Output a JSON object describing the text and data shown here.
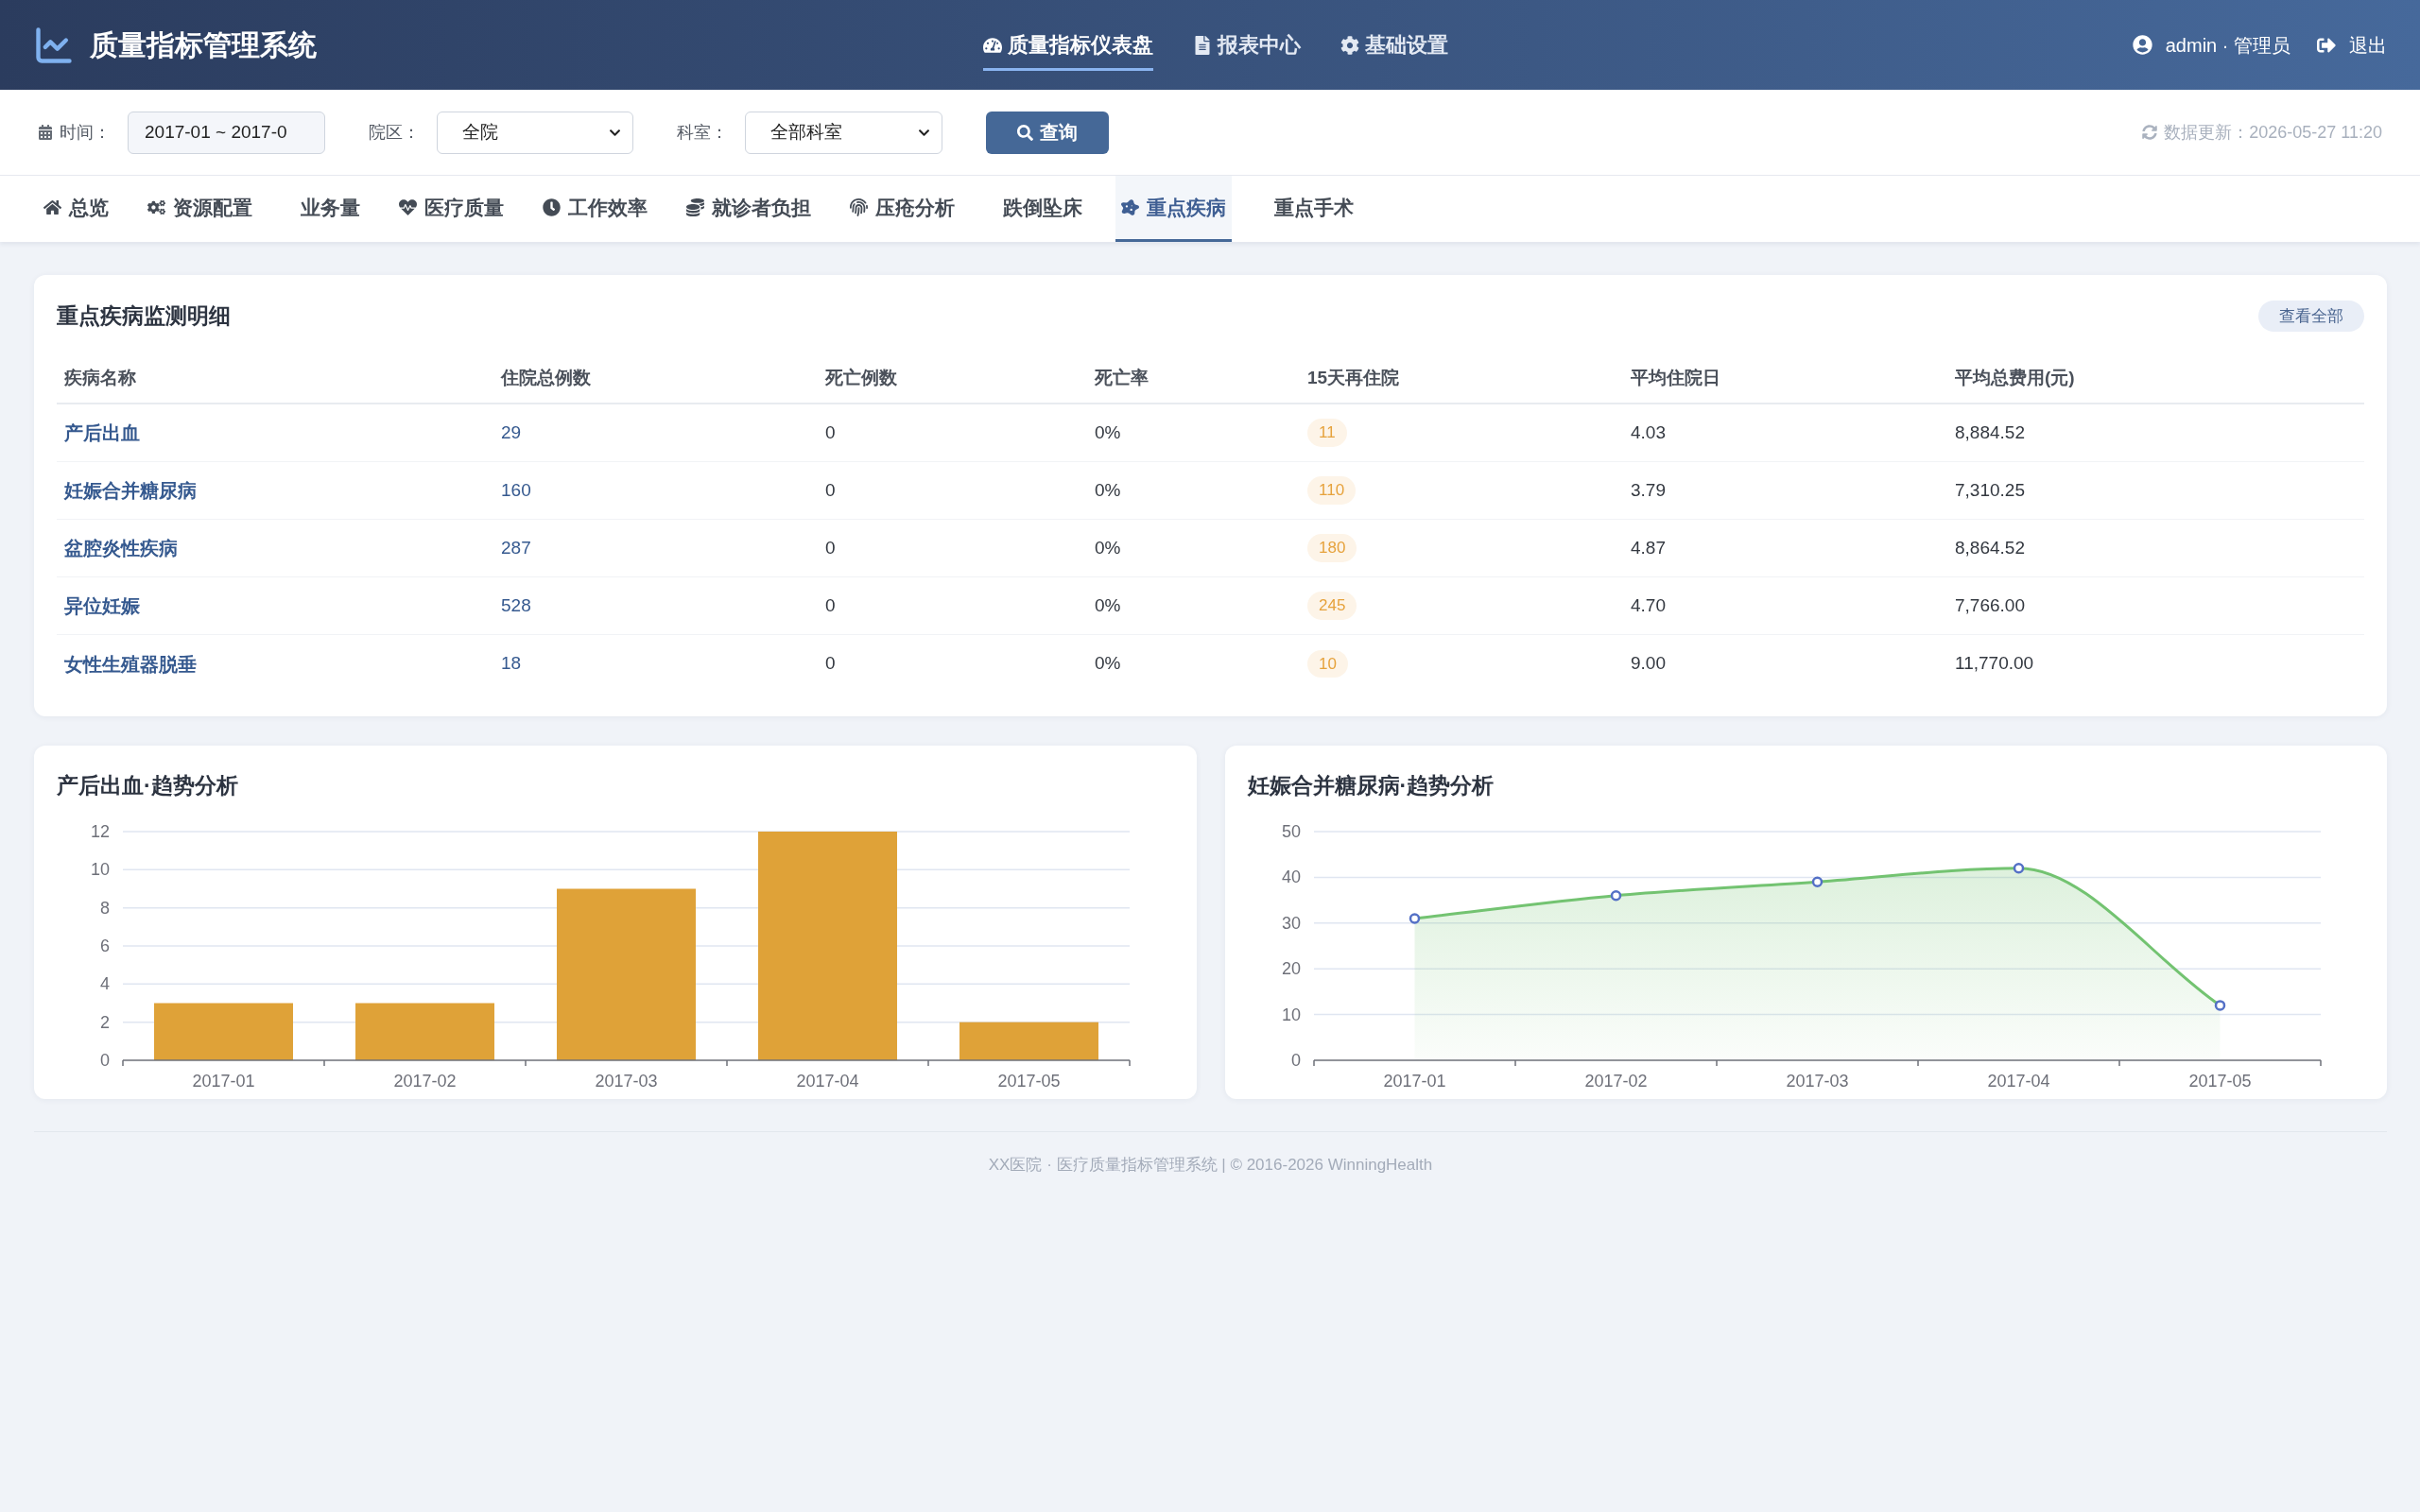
{
  "header": {
    "title": "质量指标管理系统",
    "nav": [
      {
        "label": "质量指标仪表盘",
        "selected": true
      },
      {
        "label": "报表中心",
        "selected": false
      },
      {
        "label": "基础设置",
        "selected": false
      }
    ],
    "user": "admin · 管理员",
    "logout": "退出"
  },
  "filters": {
    "date": {
      "label": "时间：",
      "value": "2017-01 ~ 2017-0"
    },
    "campus": {
      "label": "院区：",
      "value": "全院"
    },
    "department": {
      "label": "科室：",
      "value": "全部科室"
    },
    "search_button": "查询",
    "last_updated": "数据更新：2026-05-27 11:20"
  },
  "tabs": [
    {
      "label": "总览",
      "selected": false
    },
    {
      "label": "资源配置",
      "selected": false
    },
    {
      "label": "业务量",
      "selected": false
    },
    {
      "label": "医疗质量",
      "selected": false
    },
    {
      "label": "工作效率",
      "selected": false
    },
    {
      "label": "就诊者负担",
      "selected": false
    },
    {
      "label": "压疮分析",
      "selected": false
    },
    {
      "label": "跌倒坠床",
      "selected": false
    },
    {
      "label": "重点疾病",
      "selected": true
    },
    {
      "label": "重点手术",
      "selected": false
    }
  ],
  "detail": {
    "title": "重点疾病监测明细",
    "view_all": "查看全部",
    "table": {
      "columns": [
        "疾病名称",
        "住院总例数",
        "死亡例数",
        "死亡率",
        "15天再住院",
        "平均住院日",
        "平均总费用(元)"
      ],
      "rows": [
        [
          "产后出血",
          "29",
          "0",
          "0%",
          "11",
          "4.03",
          "8,884.52"
        ],
        [
          "妊娠合并糖尿病",
          "160",
          "0",
          "0%",
          "110",
          "3.79",
          "7,310.25"
        ],
        [
          "盆腔炎性疾病",
          "287",
          "0",
          "0%",
          "180",
          "4.87",
          "8,864.52"
        ],
        [
          "异位妊娠",
          "528",
          "0",
          "0%",
          "245",
          "4.70",
          "7,766.00"
        ],
        [
          "女性生殖器脱垂",
          "18",
          "0",
          "0%",
          "10",
          "9.00",
          "11,770.00"
        ]
      ]
    }
  },
  "charts": [
    {
      "chart_data": {
        "type": "bar",
        "title": "产后出血·趋势分析",
        "categories": [
          "2017-01",
          "2017-02",
          "2017-03",
          "2017-04",
          "2017-05"
        ],
        "values": [
          3,
          3,
          9,
          12,
          2
        ],
        "color": "#dfa238",
        "ylim": [
          0,
          12
        ],
        "yticks": [
          0,
          2,
          4,
          6,
          8,
          10,
          12
        ],
        "grid": true
      }
    },
    {
      "chart_data": {
        "type": "area",
        "title": "妊娠合并糖尿病·趋势分析",
        "categories": [
          "2017-01",
          "2017-02",
          "2017-03",
          "2017-04",
          "2017-05"
        ],
        "values": [
          31,
          36,
          39,
          42,
          12
        ],
        "color": "#73c371",
        "ylim": [
          0,
          50
        ],
        "yticks": [
          0,
          10,
          20,
          30,
          40,
          50
        ],
        "grid": true,
        "marker": "circle"
      }
    }
  ],
  "footer": "XX医院 · 医疗质量指标管理系统 | © 2016-2026 WinningHealth"
}
